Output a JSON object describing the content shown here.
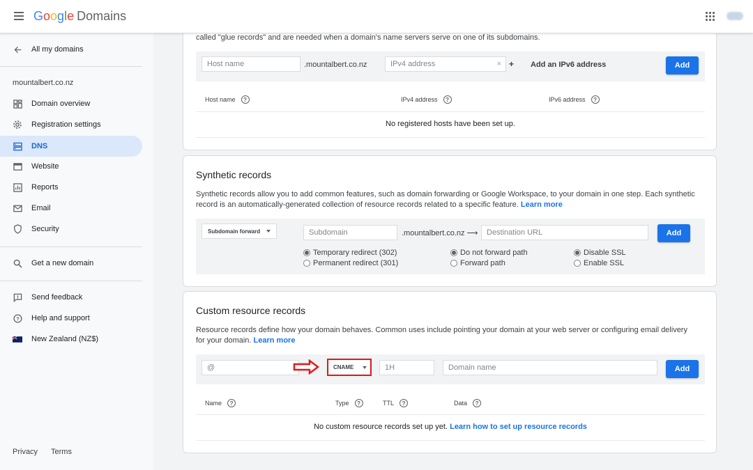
{
  "header": {
    "logo_letters": [
      "G",
      "o",
      "o",
      "g",
      "l",
      "e"
    ],
    "product": "Domains"
  },
  "sidebar": {
    "back_link": "All my domains",
    "domain": "mountalbert.co.nz",
    "items": [
      {
        "label": "Domain overview",
        "icon": "grid-icon"
      },
      {
        "label": "Registration settings",
        "icon": "gear-icon"
      },
      {
        "label": "DNS",
        "icon": "dns-icon",
        "active": true
      },
      {
        "label": "Website",
        "icon": "website-icon"
      },
      {
        "label": "Reports",
        "icon": "reports-icon"
      },
      {
        "label": "Email",
        "icon": "email-icon"
      },
      {
        "label": "Security",
        "icon": "shield-icon"
      }
    ],
    "get_domain": "Get a new domain",
    "feedback": "Send feedback",
    "help": "Help and support",
    "region": "New Zealand (NZ$)",
    "footer": {
      "privacy": "Privacy",
      "terms": "Terms"
    }
  },
  "glue": {
    "desc_tail": "called \"glue records\" and are needed when a domain's name servers serve on one of its subdomains.",
    "host_placeholder": "Host name",
    "suffix": ".mountalbert.co.nz",
    "ipv4_placeholder": "IPv4 address",
    "clear": "×",
    "plus": "+",
    "add_ipv6": "Add an IPv6 address",
    "add": "Add",
    "columns": [
      "Host name",
      "IPv4 address",
      "IPv6 address"
    ],
    "empty": "No registered hosts have been set up."
  },
  "synthetic": {
    "title": "Synthetic records",
    "desc": "Synthetic records allow you to add common features, such as domain forwarding or Google Workspace, to your domain in one step. Each synthetic record is an automatically-generated collection of resource records related to a specific feature.",
    "learn_more": "Learn more",
    "type_select": "Subdomain forward",
    "subdomain_placeholder": "Subdomain",
    "suffix": ".mountalbert.co.nz",
    "arrow": "⟶",
    "dest_placeholder": "Destination URL",
    "add": "Add",
    "radios": {
      "temporary": "Temporary redirect (302)",
      "permanent": "Permanent redirect (301)",
      "no_forward_path": "Do not forward path",
      "forward_path": "Forward path",
      "disable_ssl": "Disable SSL",
      "enable_ssl": "Enable SSL"
    }
  },
  "custom": {
    "title": "Custom resource records",
    "desc": "Resource records define how your domain behaves. Common uses include pointing your domain at your web server or configuring email delivery for your domain.",
    "learn_more": "Learn more",
    "name_placeholder": "@",
    "type_select": "CNAME",
    "ttl_placeholder": "1H",
    "data_placeholder": "Domain name",
    "add": "Add",
    "columns": [
      "Name",
      "Type",
      "TTL",
      "Data"
    ],
    "empty": "No custom resource records set up yet.",
    "empty_link": "Learn how to set up resource records"
  },
  "colors": {
    "accent": "#1a73e8",
    "active_bg": "#dbe7fb",
    "annotation": "#e0191c"
  }
}
